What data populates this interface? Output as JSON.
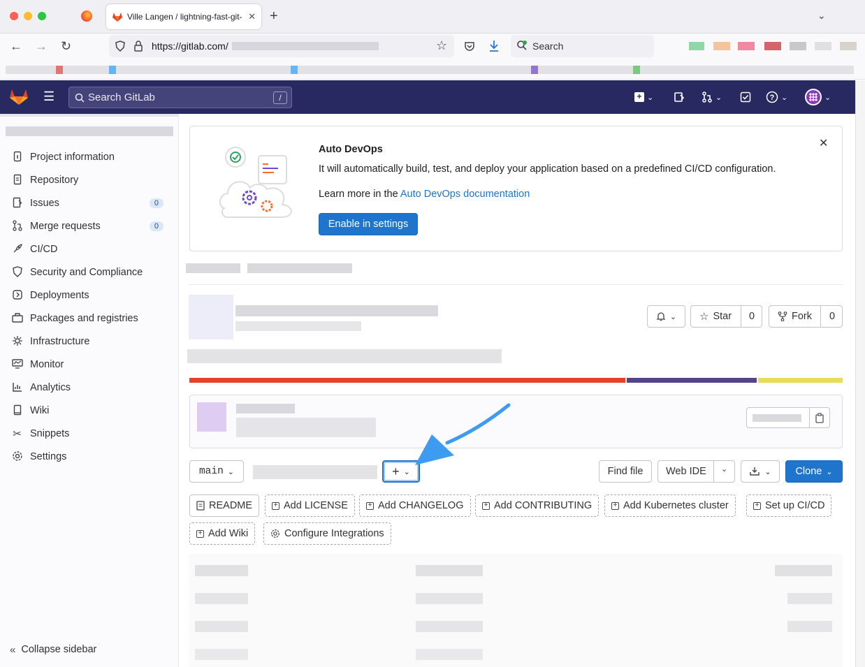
{
  "browser": {
    "tab_title": "Ville Langen / lightning-fast-git-",
    "new_tab": "+",
    "url_prefix": "https://gitlab.com/",
    "search_placeholder": "Search"
  },
  "gitlab": {
    "search_placeholder": "Search GitLab",
    "search_shortcut": "/"
  },
  "sidebar": {
    "items": [
      {
        "label": "Project information",
        "icon": "info-icon"
      },
      {
        "label": "Repository",
        "icon": "doc-icon"
      },
      {
        "label": "Issues",
        "icon": "issues-icon",
        "badge": "0"
      },
      {
        "label": "Merge requests",
        "icon": "merge-icon",
        "badge": "0"
      },
      {
        "label": "CI/CD",
        "icon": "rocket-icon"
      },
      {
        "label": "Security and Compliance",
        "icon": "shield-icon"
      },
      {
        "label": "Deployments",
        "icon": "deploy-icon"
      },
      {
        "label": "Packages and registries",
        "icon": "package-icon"
      },
      {
        "label": "Infrastructure",
        "icon": "cloud-icon"
      },
      {
        "label": "Monitor",
        "icon": "monitor-icon"
      },
      {
        "label": "Analytics",
        "icon": "chart-icon"
      },
      {
        "label": "Wiki",
        "icon": "book-icon"
      },
      {
        "label": "Snippets",
        "icon": "scissors-icon"
      },
      {
        "label": "Settings",
        "icon": "gear-icon"
      }
    ],
    "collapse": "Collapse sidebar"
  },
  "devops": {
    "title": "Auto DevOps",
    "desc": "It will automatically build, test, and deploy your application based on a predefined CI/CD configuration.",
    "learn_prefix": "Learn more in the ",
    "learn_link": "Auto DevOps documentation",
    "button": "Enable in settings"
  },
  "project": {
    "star": "Star",
    "star_count": "0",
    "fork": "Fork",
    "fork_count": "0"
  },
  "language_bar": [
    {
      "color": "#e24329",
      "fraction": 0.67
    },
    {
      "color": "#554488",
      "fraction": 0.2
    },
    {
      "color": "#e9dc58",
      "fraction": 0.13
    }
  ],
  "toolbar": {
    "branch": "main",
    "add": "+",
    "find_file": "Find file",
    "web_ide": "Web IDE",
    "clone": "Clone"
  },
  "quick_actions": [
    "README",
    "Add LICENSE",
    "Add CHANGELOG",
    "Add CONTRIBUTING",
    "Add Kubernetes cluster",
    "Set up CI/CD",
    "Add Wiki",
    "Configure Integrations"
  ]
}
